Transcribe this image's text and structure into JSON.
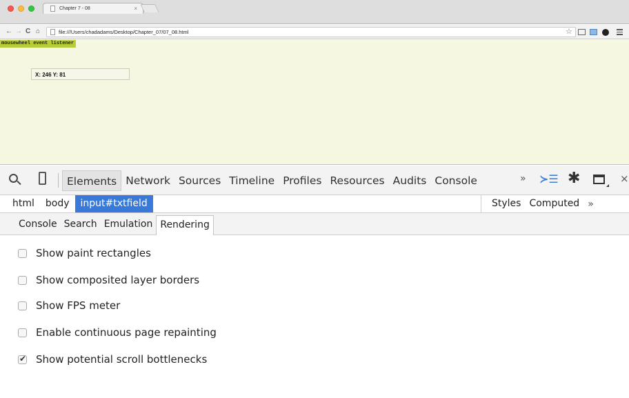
{
  "browser": {
    "tab_title": "Chapter 7 - 08",
    "tab_close": "×",
    "url": "file:///Users/chadadams/Desktop/Chapter_07/07_08.html",
    "nav": {
      "back": "←",
      "forward": "→",
      "reload": "C",
      "home": "⌂",
      "star": "☆"
    }
  },
  "page": {
    "listener_label": "mousewheel event listener",
    "field_value": "X: 246 Y: 81"
  },
  "devtools": {
    "panel_tabs": [
      "Elements",
      "Network",
      "Sources",
      "Timeline",
      "Profiles",
      "Resources",
      "Audits",
      "Console"
    ],
    "active_panel": "Elements",
    "more_tabs": "»",
    "drawer_icon": "≻☰",
    "settings_icon": "✱",
    "close_icon": "×",
    "breadcrumbs": [
      "html",
      "body",
      "input#txtfield"
    ],
    "selected_breadcrumb": "input#txtfield",
    "sidebar_tabs": [
      "Styles",
      "Computed"
    ],
    "sidebar_more": "»",
    "drawer_tabs": [
      "Console",
      "Search",
      "Emulation",
      "Rendering"
    ],
    "active_drawer_tab": "Rendering",
    "rendering_options": [
      {
        "label": "Show paint rectangles",
        "checked": false
      },
      {
        "label": "Show composited layer borders",
        "checked": false
      },
      {
        "label": "Show FPS meter",
        "checked": false
      },
      {
        "label": "Enable continuous page repainting",
        "checked": false
      },
      {
        "label": "Show potential scroll bottlenecks",
        "checked": true
      }
    ]
  },
  "colors": {
    "page_background": "#f5f7e1",
    "listener_label_bg": "#b8cd37",
    "breadcrumb_selected": "#3879d9",
    "close_light": "#fc5753",
    "minimize_light": "#fdbc40",
    "maximize_light": "#33c748"
  }
}
